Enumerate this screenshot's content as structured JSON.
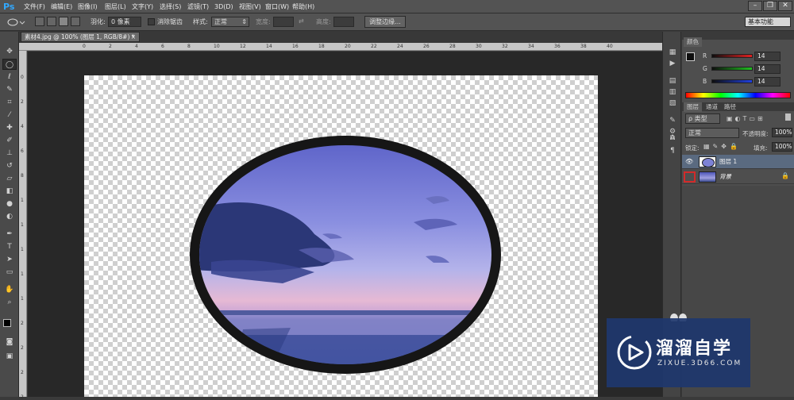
{
  "app": {
    "logo": "Ps"
  },
  "menu": [
    "文件(F)",
    "编辑(E)",
    "图像(I)",
    "图层(L)",
    "文字(Y)",
    "选择(S)",
    "滤镜(T)",
    "3D(D)",
    "视图(V)",
    "窗口(W)",
    "帮助(H)"
  ],
  "window_controls": {
    "minimize": "–",
    "restore": "❐",
    "close": "✕"
  },
  "options": {
    "feather_label": "羽化:",
    "feather_value": "0 像素",
    "antialias_label": "消除锯齿",
    "style_label": "样式:",
    "style_value": "正常",
    "width_label": "宽度:",
    "height_label": "高度:",
    "refine_button": "调整边缘...",
    "workspace_value": "基本功能"
  },
  "document_tab": {
    "label": "素材4.jpg @ 100% (图层 1, RGB/8#) *",
    "close": "×"
  },
  "ruler_top_numbers": [
    "0",
    "2",
    "4",
    "6",
    "8",
    "10",
    "12",
    "14",
    "16",
    "18",
    "20",
    "22",
    "24",
    "26",
    "28",
    "30",
    "32",
    "34",
    "36",
    "38",
    "40"
  ],
  "ruler_left_numbers": [
    "0",
    "2",
    "4",
    "6",
    "8",
    "1",
    "1",
    "1",
    "1",
    "1",
    "2",
    "2",
    "2",
    "2"
  ],
  "color_panel": {
    "title": "颜色",
    "channels": [
      {
        "label": "R",
        "value": "14",
        "color": "#e03030"
      },
      {
        "label": "G",
        "value": "14",
        "color": "#30b030"
      },
      {
        "label": "B",
        "value": "14",
        "color": "#3050e0"
      }
    ]
  },
  "layers_panel": {
    "tabs": [
      "图层",
      "通道",
      "路径"
    ],
    "filter_value": "ρ 类型",
    "blend_mode": "正常",
    "opacity_label": "不透明度:",
    "opacity_value": "100%",
    "lock_label": "锁定:",
    "fill_label": "填充:",
    "fill_value": "100%",
    "layers": [
      {
        "name": "图层 1",
        "visible": true,
        "selected": true
      },
      {
        "name": "背景",
        "visible": false,
        "selected": false,
        "locked": true
      }
    ]
  },
  "watermark": {
    "title": "溜溜自学",
    "url": "ZIXUE.3D66.COM"
  },
  "colors": {
    "accent_blue": "#31a8ff",
    "selected_layer": "#5a6a80",
    "highlight_red": "#d32a2a"
  }
}
